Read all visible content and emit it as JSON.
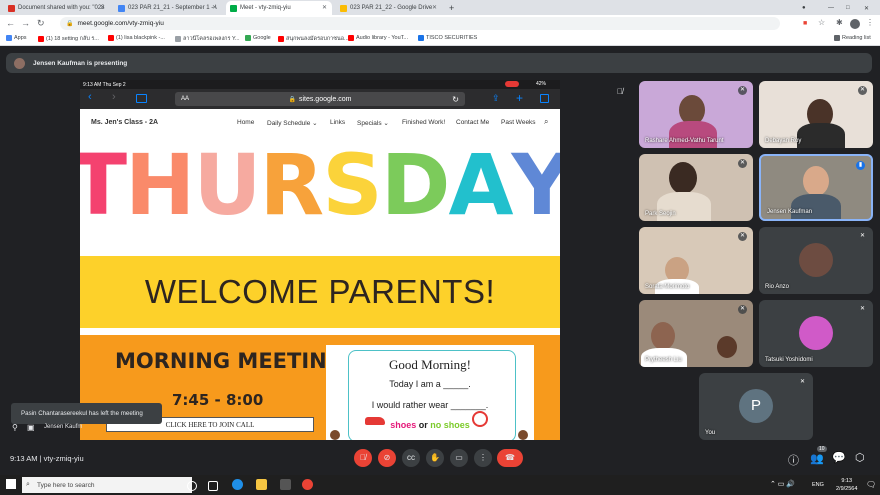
{
  "browser": {
    "tabs": [
      {
        "label": "Document shared with you: \"023",
        "color": "#d93025"
      },
      {
        "label": "023 PAR 21_21 - September 1 - \\",
        "color": "#4285f4"
      },
      {
        "label": "Meet - vty-zmiq-yiu",
        "color": "#00ac47"
      },
      {
        "label": "023 PAR 21_22 - Google Drive",
        "color": "#fbbc04"
      }
    ],
    "url": "meet.google.com/vty-zmiq-yiu",
    "bookmarks": [
      "Apps",
      "(1) 18 setting กลับ ร...",
      "(1) lisa blackpink -...",
      "ลาวนีโคลรอเพลงกร Y...",
      "Google",
      "สนุกพนลงมัดรอบกาซนอ...",
      "Audio library - YouT...",
      "TISCO SECURITIES"
    ],
    "reading_list": "Reading list"
  },
  "meet": {
    "presenting_banner": "Jensen Kaufman is presenting",
    "meeting_code": "9:13 AM  |  vty-zmiq-yiu",
    "toast": "Pasin Chantarasereekul has left the meeting",
    "presenter_label": "Jensen Kaufm",
    "participants_count": "10"
  },
  "ipad": {
    "time": "9:13 AM   Thu Sep 2",
    "battery": "42%",
    "text_size": "AA",
    "url": "sites.google.com"
  },
  "site": {
    "class_name": "Ms. Jen's Class - 2A",
    "nav": [
      "Home",
      "Daily Schedule",
      "Links",
      "Specials",
      "Finished Work!",
      "Contact Me",
      "Past Weeks"
    ],
    "day": "THURSDAY",
    "day_colors": [
      "#f4426f",
      "#fa8a6a",
      "#f6aaa0",
      "#f7a23b",
      "#fbd33a",
      "#7ccb5b",
      "#22c0cd",
      "#5f88d6",
      "#c7b0e8"
    ],
    "welcome": "WELCOME PARENTS!",
    "morning_title": "MORNING MEETING",
    "morning_time": "7:45 - 8:00",
    "join_button": "CLICK HERE TO JOIN CALL",
    "card": {
      "title": "Good Morning!",
      "line1": "Today I am a _____.",
      "line2": "I would rather wear _______.",
      "option_a": "shoes",
      "or": "or",
      "option_b": "no shoes"
    }
  },
  "participants": [
    {
      "name": "Rashare Ahmed-Vathu Tarunt",
      "muted": true
    },
    {
      "name": "Debayan Roy",
      "muted": true
    },
    {
      "name": "Park Seojin",
      "muted": true
    },
    {
      "name": "Jensen Kaufman",
      "muted": false
    },
    {
      "name": "Sorata Morimoto",
      "muted": true
    },
    {
      "name": "Rio Anzo",
      "muted": true
    },
    {
      "name": "Prytheesh Liu",
      "muted": true
    },
    {
      "name": "Tatsuki Yoshidomi",
      "muted": true
    },
    {
      "name": "You",
      "initial": "P",
      "muted": true
    }
  ],
  "taskbar": {
    "search_placeholder": "Type here to search",
    "lang": "ENG",
    "time": "9:13",
    "date": "2/9/2564"
  }
}
